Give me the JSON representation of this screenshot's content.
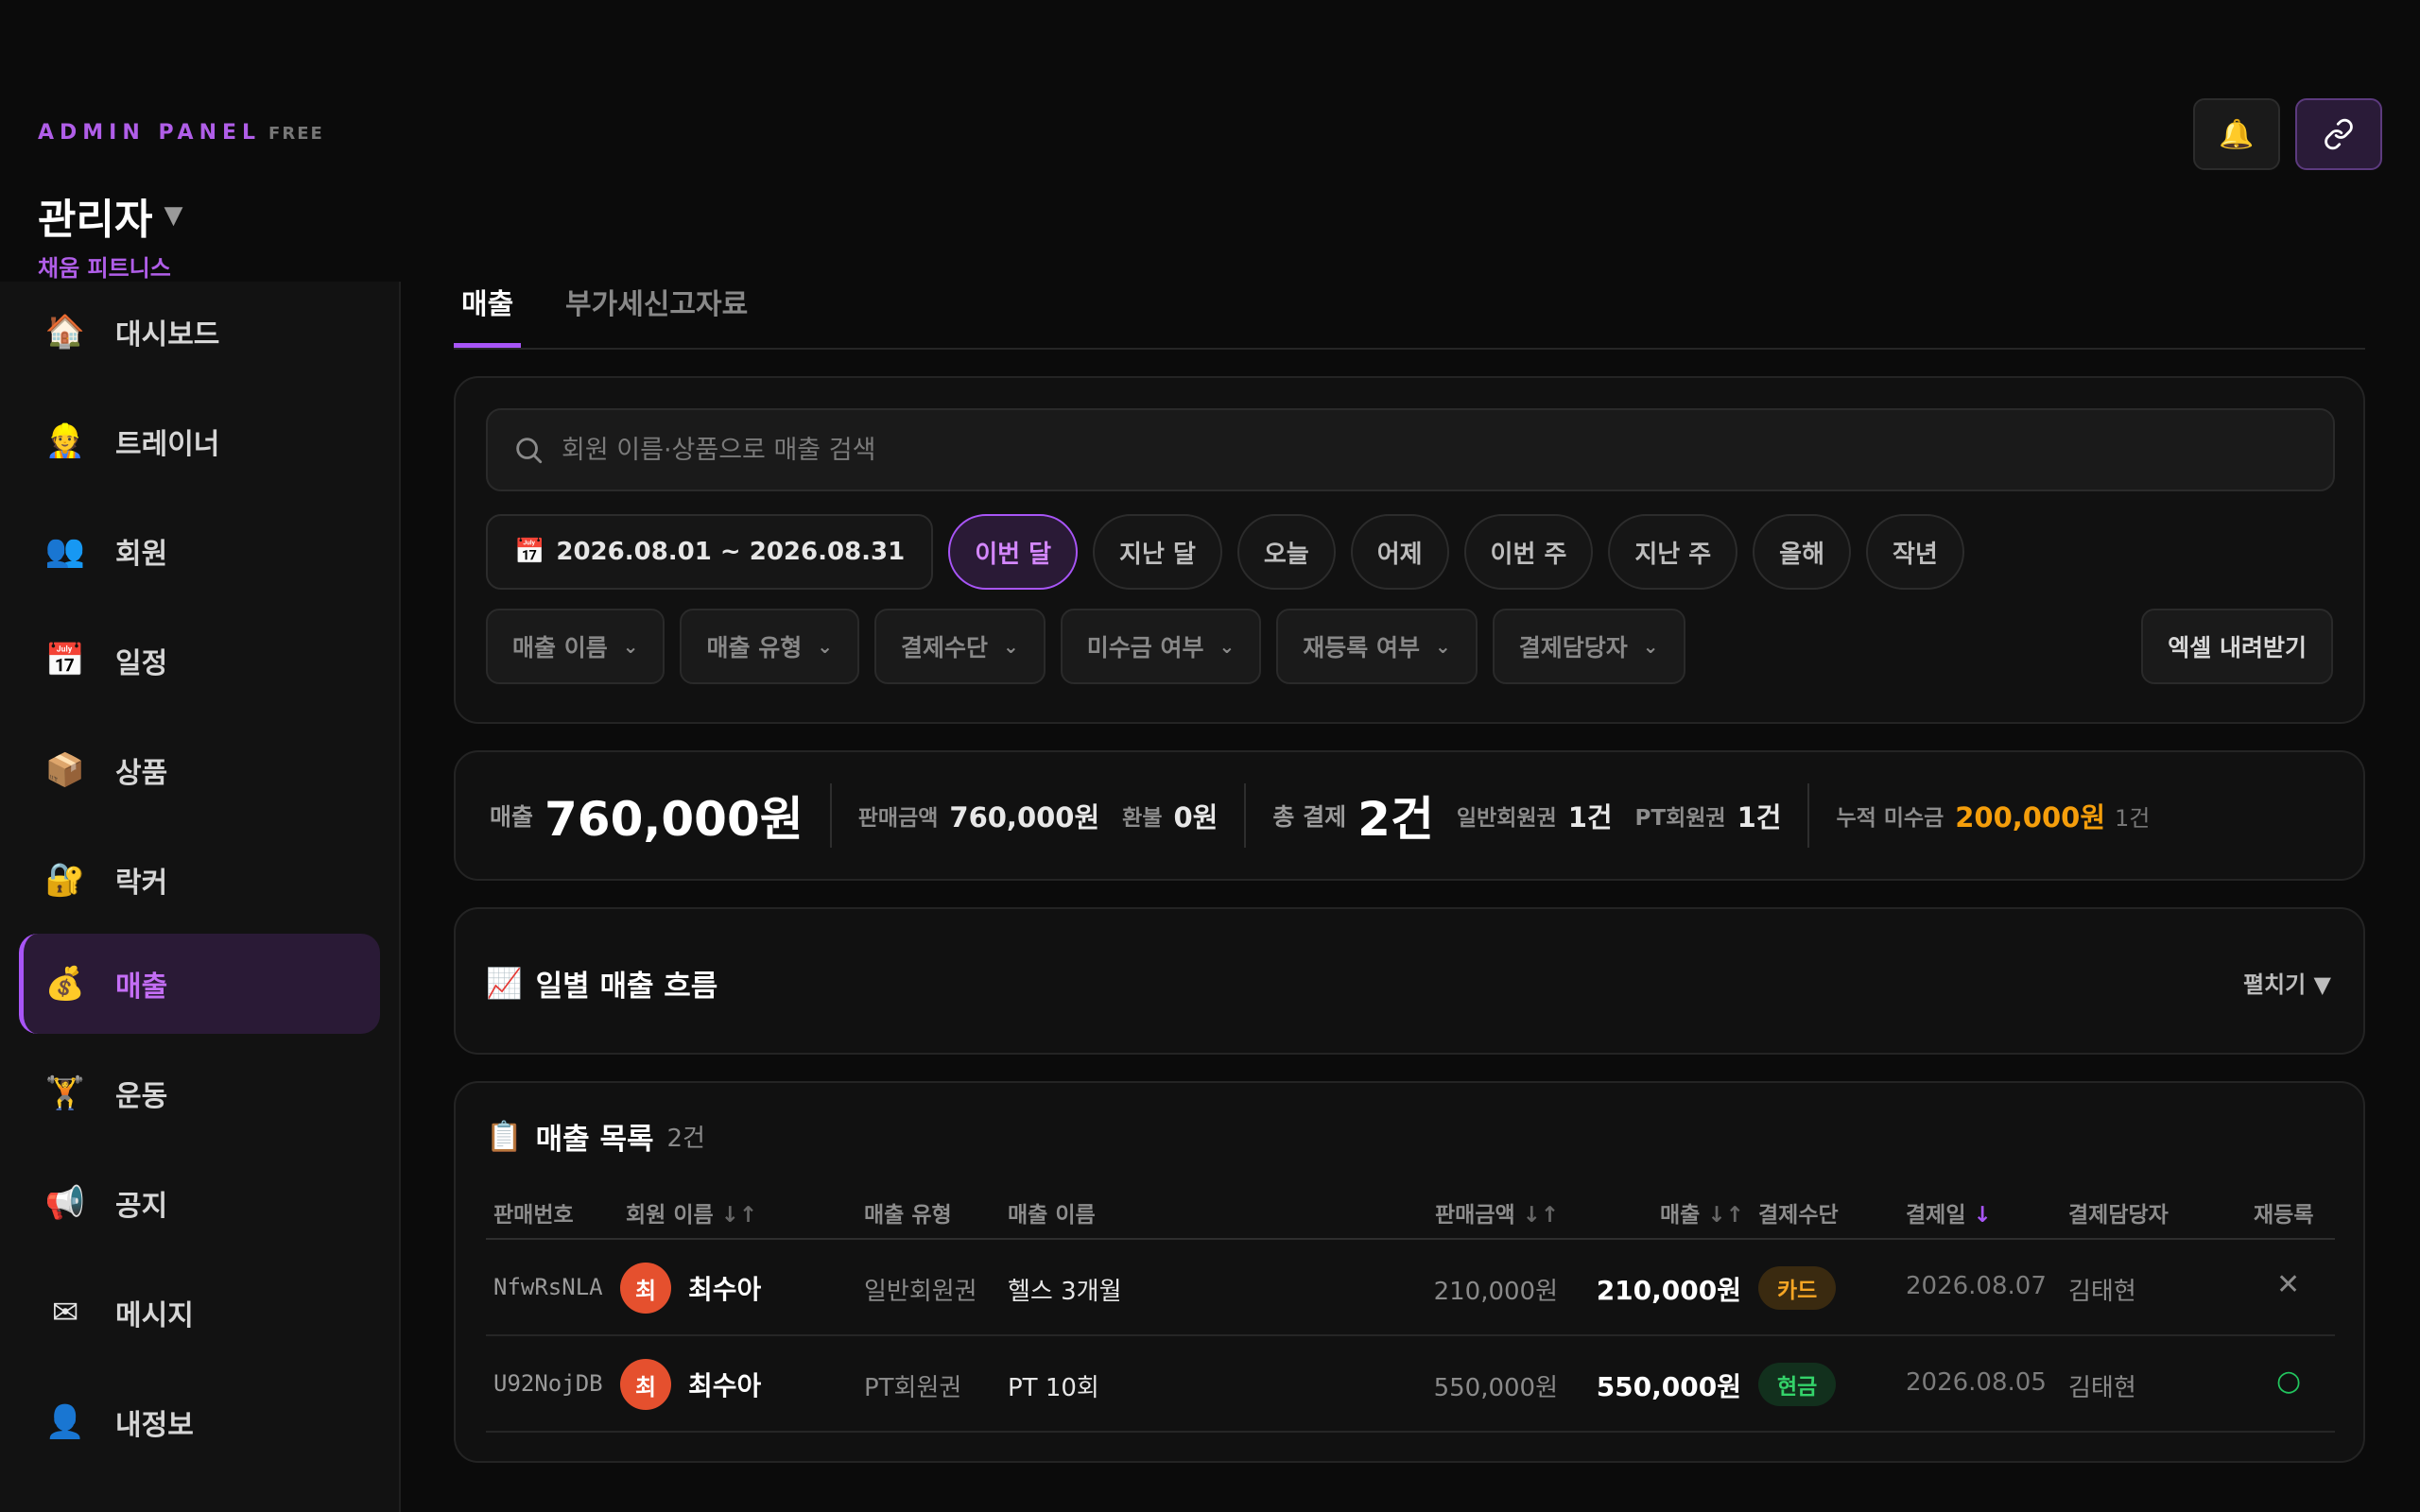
{
  "header": {
    "brand": "ADMIN PANEL",
    "plan_badge": "FREE",
    "role": "관리자",
    "gym_name": "채움 피트니스"
  },
  "sidebar": {
    "items": [
      {
        "label": "대시보드",
        "icon": "house-icon",
        "glyph": "🏠"
      },
      {
        "label": "트레이너",
        "icon": "trainer-icon",
        "glyph": "👷"
      },
      {
        "label": "회원",
        "icon": "members-icon",
        "glyph": "👥"
      },
      {
        "label": "일정",
        "icon": "calendar-icon",
        "glyph": "📅"
      },
      {
        "label": "상품",
        "icon": "package-icon",
        "glyph": "📦"
      },
      {
        "label": "락커",
        "icon": "lock-key-icon",
        "glyph": "🔐"
      },
      {
        "label": "매출",
        "icon": "money-bag-icon",
        "glyph": "💰",
        "active": true
      },
      {
        "label": "운동",
        "icon": "weightlifter-icon",
        "glyph": "🏋"
      },
      {
        "label": "공지",
        "icon": "megaphone-icon",
        "glyph": "📢"
      },
      {
        "label": "메시지",
        "icon": "envelope-icon",
        "glyph": "✉"
      },
      {
        "label": "내정보",
        "icon": "user-icon",
        "glyph": "👤"
      }
    ]
  },
  "tabs": [
    {
      "label": "매출",
      "active": true
    },
    {
      "label": "부가세신고자료",
      "active": false
    }
  ],
  "search": {
    "placeholder": "회원 이름·상품으로 매출 검색",
    "value": ""
  },
  "date_range": "2026.08.01 ~ 2026.08.31",
  "period_chips": [
    {
      "label": "이번 달",
      "active": true
    },
    {
      "label": "지난 달",
      "active": false
    },
    {
      "label": "오늘",
      "active": false
    },
    {
      "label": "어제",
      "active": false
    },
    {
      "label": "이번 주",
      "active": false
    },
    {
      "label": "지난 주",
      "active": false
    },
    {
      "label": "올해",
      "active": false
    },
    {
      "label": "작년",
      "active": false
    }
  ],
  "filters": [
    "매출 이름",
    "매출 유형",
    "결제수단",
    "미수금 여부",
    "재등록 여부",
    "결제담당자"
  ],
  "excel_label": "엑셀 내려받기",
  "summary": {
    "sales_label": "매출",
    "sales_value": "760,000원",
    "gross_label": "판매금액",
    "gross_value": "760,000원",
    "refund_label": "환불",
    "refund_value": "0원",
    "total_pay_label": "총 결제",
    "total_pay_value": "2건",
    "general_label": "일반회원권",
    "general_value": "1건",
    "pt_label": "PT회원권",
    "pt_value": "1건",
    "unpaid_label": "누적 미수금",
    "unpaid_value": "200,000원",
    "unpaid_count": "1건"
  },
  "daily_flow": {
    "title": "일별 매출 흐름",
    "expand_label": "펼치기 ▼"
  },
  "sales_list": {
    "title": "매출 목록",
    "count": "2건",
    "columns": {
      "code": "판매번호",
      "member": "회원 이름",
      "type": "매출 유형",
      "product": "매출 이름",
      "amount": "판매금액",
      "sales": "매출",
      "pay_method": "결제수단",
      "pay_date": "결제일",
      "staff": "결제담당자",
      "renew": "재등록"
    },
    "sort_glyphs": {
      "both": "↓↑",
      "desc": "↓"
    },
    "rows": [
      {
        "code": "NfwRsNLA",
        "avatar": "최",
        "member": "최수아",
        "type": "일반회원권",
        "product": "헬스 3개월",
        "amount": "210,000원",
        "sales": "210,000원",
        "pay_method": "카드",
        "pay_date": "2026.08.07",
        "staff": "김태현",
        "renew_mark": "✕"
      },
      {
        "code": "U92NojDB",
        "avatar": "최",
        "member": "최수아",
        "type": "PT회원권",
        "product": "PT 10회",
        "amount": "550,000원",
        "sales": "550,000원",
        "pay_method": "현금",
        "pay_date": "2026.08.05",
        "staff": "김태현",
        "renew_mark": "○"
      }
    ]
  },
  "colors": {
    "accent": "#a855f7",
    "background": "#0b0b0b",
    "unpaid": "#f59e0b",
    "card_badge": "#f5a524",
    "cash_badge": "#34d36a",
    "avatar": "#e5502e"
  }
}
